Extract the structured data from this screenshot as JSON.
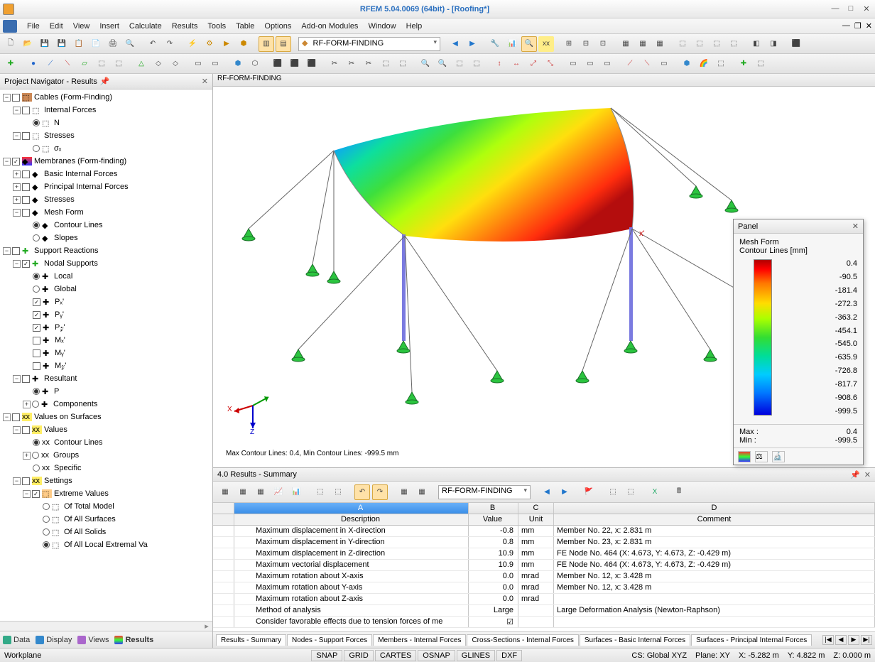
{
  "title": "RFEM 5.04.0069 (64bit) - [Roofing*]",
  "menu": [
    "File",
    "Edit",
    "View",
    "Insert",
    "Calculate",
    "Results",
    "Tools",
    "Table",
    "Options",
    "Add-on Modules",
    "Window",
    "Help"
  ],
  "toolbar_combo": "RF-FORM-FINDING",
  "nav_title": "Project Navigator - Results",
  "tree": {
    "cables": "Cables (Form-Finding)",
    "internal_forces": "Internal Forces",
    "n": "N",
    "stresses": "Stresses",
    "sigma_x": "σₓ",
    "membranes": "Membranes (Form-finding)",
    "basic_if": "Basic Internal Forces",
    "princ_if": "Principal Internal Forces",
    "m_stresses": "Stresses",
    "mesh_form": "Mesh Form",
    "contour_lines": "Contour Lines",
    "slopes": "Slopes",
    "support_reactions": "Support Reactions",
    "nodal_supports": "Nodal Supports",
    "local": "Local",
    "global": "Global",
    "px": "Pₓ'",
    "py": "Pᵧ'",
    "pz": "P𝓏'",
    "mx": "Mₓ'",
    "my": "Mᵧ'",
    "mz": "M𝓏'",
    "resultant": "Resultant",
    "p": "P",
    "components": "Components",
    "values_surfaces": "Values on Surfaces",
    "values": "Values",
    "v_contour": "Contour Lines",
    "groups": "Groups",
    "specific": "Specific",
    "settings": "Settings",
    "extreme": "Extreme Values",
    "total_model": "Of Total Model",
    "all_surfaces": "Of All Surfaces",
    "all_solids": "Of All Solids",
    "all_local": "Of All Local Extremal Va"
  },
  "nav_tabs": [
    "Data",
    "Display",
    "Views",
    "Results"
  ],
  "view_label": "RF-FORM-FINDING",
  "contour_label": "Max Contour Lines: 0.4, Min Contour Lines: -999.5 mm",
  "results_title": "4.0 Results - Summary",
  "results_combo": "RF-FORM-FINDING",
  "table_head_letters": [
    "A",
    "B",
    "C",
    "D"
  ],
  "table_head_names": [
    "Description",
    "Value",
    "Unit",
    "Comment"
  ],
  "table_rows": [
    {
      "desc": "Maximum displacement in X-direction",
      "val": "-0.8",
      "unit": "mm",
      "comm": "Member No. 22,  x: 2.831 m"
    },
    {
      "desc": "Maximum displacement in Y-direction",
      "val": "0.8",
      "unit": "mm",
      "comm": "Member No. 23,  x: 2.831 m"
    },
    {
      "desc": "Maximum displacement in Z-direction",
      "val": "10.9",
      "unit": "mm",
      "comm": "FE Node No. 464  (X: 4.673,  Y: 4.673,  Z: -0.429 m)"
    },
    {
      "desc": "Maximum vectorial displacement",
      "val": "10.9",
      "unit": "mm",
      "comm": "FE Node No. 464  (X: 4.673,  Y: 4.673,  Z: -0.429 m)"
    },
    {
      "desc": "Maximum rotation about X-axis",
      "val": "0.0",
      "unit": "mrad",
      "comm": "Member No. 12,  x: 3.428 m"
    },
    {
      "desc": "Maximum rotation about Y-axis",
      "val": "0.0",
      "unit": "mrad",
      "comm": "Member No. 12,  x: 3.428 m"
    },
    {
      "desc": "Maximum rotation about Z-axis",
      "val": "0.0",
      "unit": "mrad",
      "comm": ""
    },
    {
      "desc": "Method of analysis",
      "val": "Large",
      "unit": "",
      "comm": "Large Deformation Analysis (Newton-Raphson)"
    },
    {
      "desc": "Consider favorable effects due to tension forces of me",
      "val": "☑",
      "unit": "",
      "comm": ""
    }
  ],
  "result_tabs": [
    "Results - Summary",
    "Nodes - Support Forces",
    "Members - Internal Forces",
    "Cross-Sections - Internal Forces",
    "Surfaces - Basic Internal Forces",
    "Surfaces - Principal Internal Forces"
  ],
  "panel": {
    "title": "Panel",
    "h1": "Mesh Form",
    "h2": "Contour Lines [mm]",
    "scale": [
      "0.4",
      "-90.5",
      "-181.4",
      "-272.3",
      "-363.2",
      "-454.1",
      "-545.0",
      "-635.9",
      "-726.8",
      "-817.7",
      "-908.6",
      "-999.5"
    ],
    "max_lbl": "Max   :",
    "max_val": "0.4",
    "min_lbl": "Min   :",
    "min_val": "-999.5"
  },
  "status": {
    "left": "Workplane",
    "btns": [
      "SNAP",
      "GRID",
      "CARTES",
      "OSNAP",
      "GLINES",
      "DXF"
    ],
    "cs": "CS: Global XYZ",
    "plane": "Plane: XY",
    "x": "X:  -5.282 m",
    "y": "Y:  4.822 m",
    "z": "Z:  0.000 m"
  },
  "axis_x": "X",
  "axis_z": "Z"
}
